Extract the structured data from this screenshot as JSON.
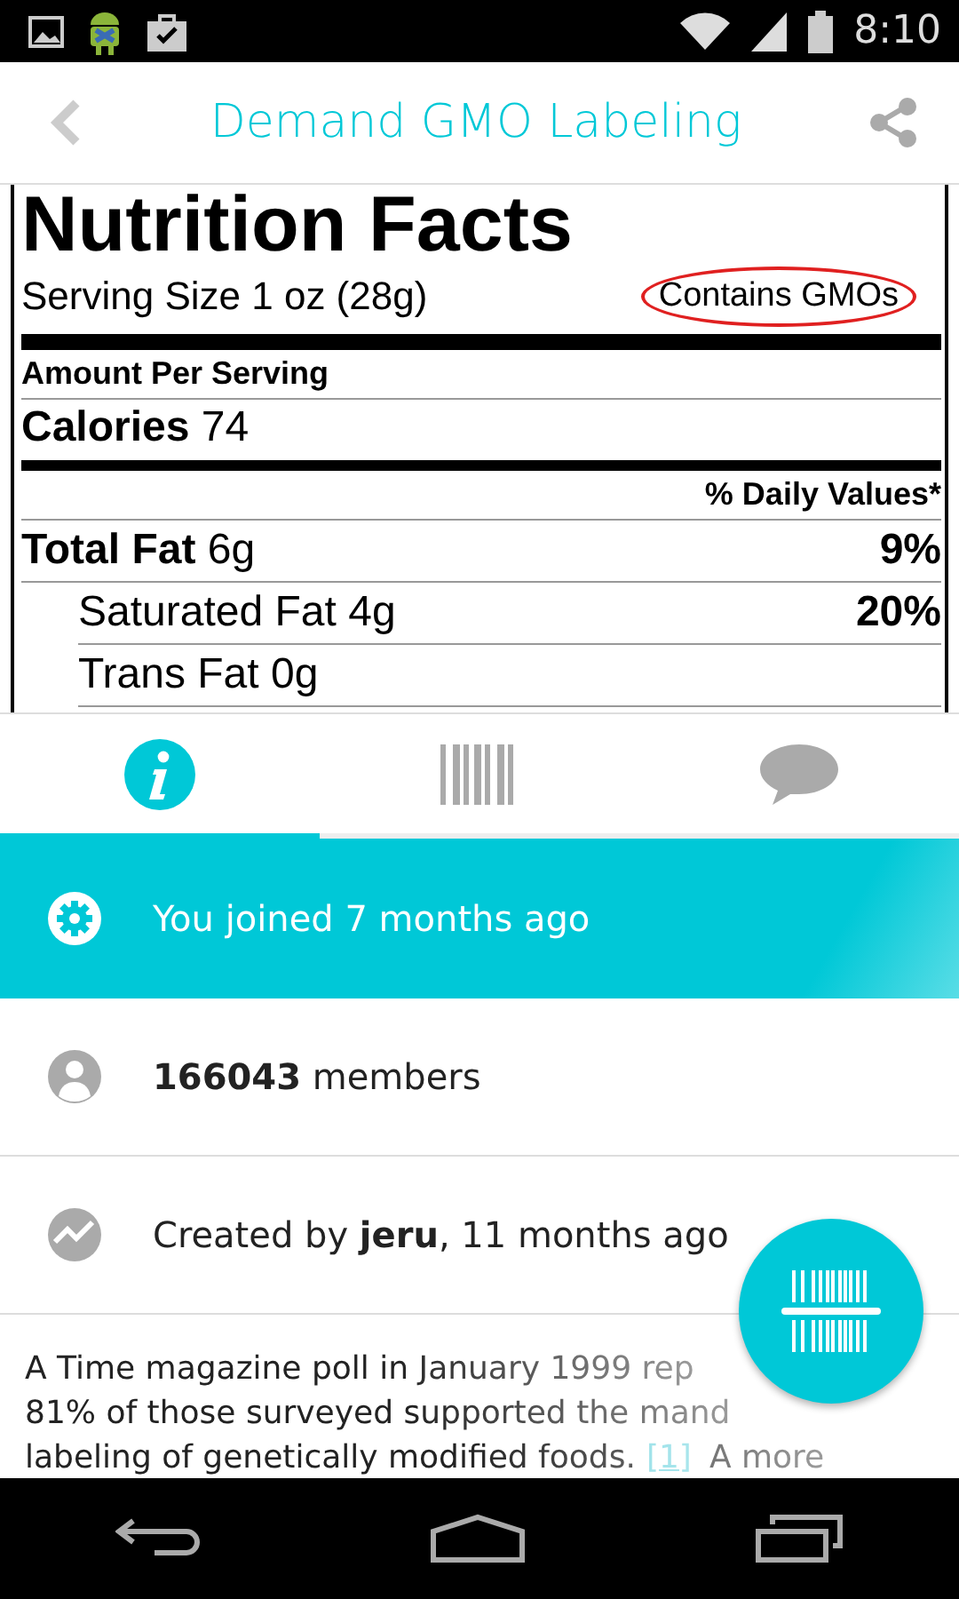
{
  "status_bar": {
    "time": "8:10"
  },
  "header": {
    "title": "Demand GMO Labeling"
  },
  "label": {
    "headline": "Nutrition Facts",
    "serving": "Serving Size 1 oz (28g)",
    "note": "Contains GMOs",
    "amount": "Amount Per Serving",
    "calories_label": "Calories",
    "calories": "74",
    "daily_header": "% Daily Values*",
    "rows": [
      {
        "name": "Total Fat",
        "amount": "6g",
        "percent": "9%",
        "kind": "main"
      },
      {
        "name": "Saturated Fat",
        "amount": "4g",
        "percent": "20%",
        "kind": "sub"
      },
      {
        "name": "Trans Fat",
        "amount": "0g",
        "kind": "sub"
      }
    ]
  },
  "tabs": [
    {
      "kind": "info",
      "selected": true
    },
    {
      "kind": "barcode",
      "selected": false
    },
    {
      "kind": "chat",
      "selected": false
    }
  ],
  "info_rows": [
    {
      "kind": "joined",
      "text": "You joined 7 months ago",
      "highlighted": true
    },
    {
      "kind": "members",
      "text": "**166043** members",
      "highlighted": false
    },
    {
      "kind": "created",
      "text": "Created by **jeru**, 11 months ago",
      "highlighted": false
    }
  ],
  "description": {
    "lines": [
      {
        "text": "A Time magazine poll in January 1999 rep"
      },
      {
        "text": "81% of those surveyed supported the mand"
      },
      {
        "text": "labeling of genetically modified foods.",
        "link": "[1]",
        "after": "A more"
      }
    ]
  }
}
